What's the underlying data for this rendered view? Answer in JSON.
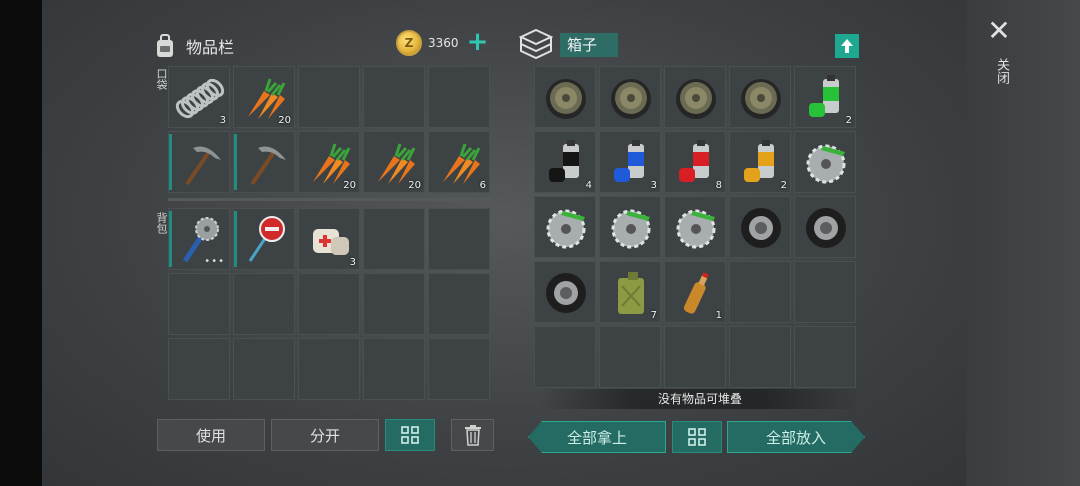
{
  "inventory": {
    "title": "物品栏",
    "coins": "3360",
    "coin_icon_letter": "Z",
    "pockets_label": "口袋",
    "backpack_label": "背包",
    "pockets": [
      {
        "icon": "spring-icon",
        "qty": "3"
      },
      {
        "icon": "carrot-icon",
        "qty": "20"
      },
      {
        "icon": "",
        "qty": ""
      },
      {
        "icon": "",
        "qty": ""
      },
      {
        "icon": "",
        "qty": ""
      },
      {
        "icon": "pickaxe-icon",
        "qty": "",
        "durability": true
      },
      {
        "icon": "pickaxe-icon",
        "qty": "",
        "durability": true
      },
      {
        "icon": "carrot-icon",
        "qty": "20"
      },
      {
        "icon": "carrot-icon",
        "qty": "20"
      },
      {
        "icon": "carrot-icon",
        "qty": "6"
      }
    ],
    "backpack": [
      {
        "icon": "saw-weapon-icon",
        "qty": "",
        "durability": true,
        "dots": "•••"
      },
      {
        "icon": "stop-sign-icon",
        "qty": "",
        "durability": true
      },
      {
        "icon": "bandage-icon",
        "qty": "3"
      },
      {
        "icon": "",
        "qty": ""
      },
      {
        "icon": "",
        "qty": ""
      },
      {
        "icon": "",
        "qty": ""
      },
      {
        "icon": "",
        "qty": ""
      },
      {
        "icon": "",
        "qty": ""
      },
      {
        "icon": "",
        "qty": ""
      },
      {
        "icon": "",
        "qty": ""
      },
      {
        "icon": "",
        "qty": ""
      },
      {
        "icon": "",
        "qty": ""
      },
      {
        "icon": "",
        "qty": ""
      },
      {
        "icon": "",
        "qty": ""
      },
      {
        "icon": "",
        "qty": ""
      }
    ],
    "buttons": {
      "use": "使用",
      "split": "分开"
    }
  },
  "box": {
    "title": "箱子",
    "items": [
      {
        "icon": "wheel-rim-icon",
        "qty": ""
      },
      {
        "icon": "wheel-rim-icon",
        "qty": ""
      },
      {
        "icon": "wheel-rim-icon",
        "qty": ""
      },
      {
        "icon": "wheel-rim-icon",
        "qty": ""
      },
      {
        "icon": "spray-paint-green-icon",
        "qty": "2",
        "color": "#27c23a"
      },
      {
        "icon": "spray-paint-black-icon",
        "qty": "4",
        "color": "#151515"
      },
      {
        "icon": "spray-paint-blue-icon",
        "qty": "3",
        "color": "#1f5bd8"
      },
      {
        "icon": "spray-paint-red-icon",
        "qty": "8",
        "color": "#d81f24"
      },
      {
        "icon": "spray-paint-yellow-icon",
        "qty": "2",
        "color": "#e3a21a"
      },
      {
        "icon": "saw-blade-icon",
        "qty": ""
      },
      {
        "icon": "saw-blade-icon",
        "qty": ""
      },
      {
        "icon": "saw-blade-icon",
        "qty": ""
      },
      {
        "icon": "saw-blade-icon",
        "qty": ""
      },
      {
        "icon": "tire-icon",
        "qty": ""
      },
      {
        "icon": "tire-icon",
        "qty": ""
      },
      {
        "icon": "tire-icon",
        "qty": ""
      },
      {
        "icon": "jerrycan-icon",
        "qty": "7"
      },
      {
        "icon": "bottle-icon",
        "qty": "1"
      },
      {
        "icon": "",
        "qty": ""
      },
      {
        "icon": "",
        "qty": ""
      },
      {
        "icon": "",
        "qty": ""
      },
      {
        "icon": "",
        "qty": ""
      },
      {
        "icon": "",
        "qty": ""
      },
      {
        "icon": "",
        "qty": ""
      },
      {
        "icon": "",
        "qty": ""
      }
    ],
    "message": "没有物品可堆叠",
    "take_all": "全部拿上",
    "put_all": "全部放入"
  },
  "close_label": "关闭",
  "colors": {
    "accent": "#1fa891",
    "button_teal": "#236b63"
  }
}
